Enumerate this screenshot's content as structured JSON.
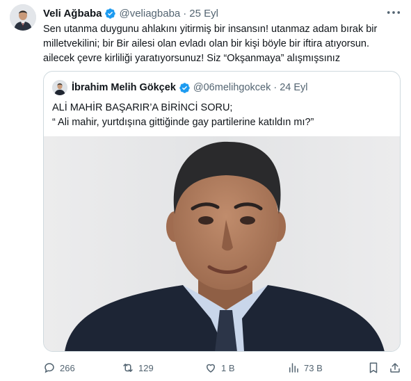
{
  "tweet": {
    "author_name": "Veli Ağbaba",
    "author_handle": "@veliagbaba",
    "separator": "·",
    "date": "25 Eyl",
    "text_lines": [
      "Sen utanma duygunu ahlakını yitirmiş bir insansın! utanmaz adam bırak bir",
      "milletvekilini; bir Bir ailesi olan evladı olan bir kişi böyle bir iftira atıyorsun.",
      "ailecek çevre kirliliği yaratıyorsunuz! Siz “Okşanmaya” alışmışsınız"
    ]
  },
  "quote": {
    "author_name": "İbrahim Melih Gökçek",
    "author_handle": "@06melihgokcek",
    "separator": "·",
    "date": "24 Eyl",
    "text_lines": [
      "ALİ MAHİR BAŞARIR’A BİRİNCİ SORU;",
      "“ Ali mahir, yurtdışına gittiğinde gay partilerine katıldın mı?”"
    ]
  },
  "actions": {
    "replies": "266",
    "reposts": "129",
    "likes": "1 B",
    "views": "73 B"
  },
  "icons": {
    "verified": "verified-badge-icon",
    "more": "more-icon",
    "reply": "reply-icon",
    "repost": "repost-icon",
    "like": "heart-icon",
    "views": "views-icon",
    "bookmark": "bookmark-icon",
    "share": "share-icon"
  },
  "colors": {
    "text": "#0f1419",
    "secondary": "#536471",
    "verified": "#1d9bf0",
    "border": "#cfd9de"
  }
}
